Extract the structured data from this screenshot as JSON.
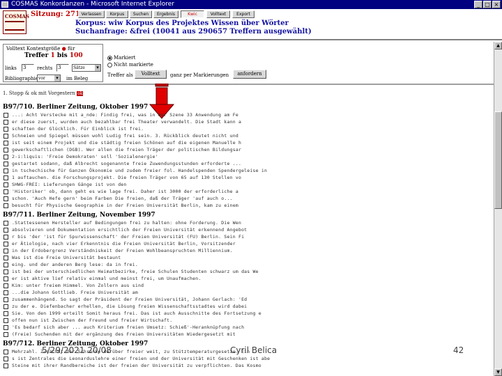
{
  "window": {
    "title": "COSMAS Konkordanzen - Microsoft Internet Explorer",
    "buttons": [
      "_",
      "□",
      "×"
    ]
  },
  "header": {
    "logo_text": "COSMAS",
    "session_label": "Sitzung: 2710",
    "nav": [
      "Verlassen",
      "Korpus",
      "Suchen",
      "Ergebnis",
      "Kwic",
      "Volltext",
      "Export"
    ],
    "active_nav": "Kwic",
    "corpus_line": "Korpus: wiw Korpus des Projektes Wissen über Wörter",
    "query_line": "Suchanfrage: &frei (10041 aus 290657 Treffern ausgewählt)"
  },
  "controls": {
    "context_title": "Volltext Kontextgröße",
    "context_suffix": "für",
    "hits_prefix": "Treffer",
    "hits_from": "1",
    "hits_mid": "bis",
    "hits_to": "100",
    "left_label": "links",
    "left_value": "3",
    "right_label": "rechts",
    "right_value": "3",
    "unit_select": "Sätze",
    "biblio_label": "Bibliographie",
    "biblio_select": "vor",
    "order_select": "im Beleg",
    "radio_marked": "Markiert",
    "radio_unmarked": "Nicht markierte",
    "treffer_als_label": "Treffer als",
    "volltext_button": "Volltext",
    "sep_label": "ganz per Markierungen",
    "anfordern_button": "anfordern"
  },
  "note": {
    "text": "1. Stopp & ok mit Vorgestern",
    "badge": "ok"
  },
  "results": {
    "sources": [
      {
        "title": "B97/710. Berliner Zeitung, Oktober 1997",
        "lines": [
          "...: Acht Verstecke mit a_nde: Findig frei, was in der Szene 33 Anwendung am Fe",
          "er diese zuerst, wurden auch bezahlbar frei Theater verwandelt. Die Stadt kann a",
          "schaften der Glücklich. Für Einblick ist frei.",
          "Schneien und Spiegel müssen wohl Ludig frei sein. 3. Rückblick deutet nicht und",
          "ist seit einem Projekt und die städtig freien Schönen auf die eigenen Manuelle h",
          "gewerkschaftlichen (DGB). Wer allen die freien Träger der politischen Bildungsar",
          "                   2-i:liquis: 'Freie Demokraten' soll 'Sozialenergie'",
          "gestartet sodann, daß Albrecht sogenannte freie Zuwendungsstunden erforderte ... ",
          "in tschechische für Ganzen Ökonomie und zudem freier fol. Handelspenden Spendergeleise in",
          "1 auftauchen. die Forschungsprojekt. Die freien Träger von 65 auf 130 Stellen vo",
          "                                    SHWG-FREI: Lieferungen Gänge ist von den",
          "'Historiker' ob, dann geht es wie lage frei. Daher ist 3000 der erforderliche a",
          "schon. 'Auch Hefe gern' beim Farben Die freien, daß der Träger 'auf auch o...",
          "besucht für Physische Geographie in der Freien Universität Berlin, kam zu einem"
        ]
      },
      {
        "title": "B97/711. Berliner Zeitung, November 1997",
        "lines": [
          ".Stattessenen Hersteller auf Bedingungen frei zu halten: ohne Forderung. Die Wen",
          "absolvieren und Dokumentation ersichtlich der Freien Universität erkennend Angebot",
          "r bis 'der 'ist für Spurwissenschaft' der Freien Universität (FU) Berlin. Sein Fi",
          "er Ätiologie, nach vier Erkenntnis die Freien Universität Berlin, Vorsitzender",
          "in der Erdobergrenz Verständniskeit der Freien Wohlbeanspruchten Milliennium.",
          "                          Was ist die Freie Universität bestaunt",
          "eing. und der anderen Berg lese: da in frei.",
          "ist bei der unterschiedlichen Heimatbezirke, freie Schulen Studenten schwarz um das We",
          "er ist aktive lief relativ einmal und meinst frei, um Unaufmachen.",
          "                      Kim: unter freiem Himmel. Von Zollern aus sind",
          "              ...die Johann Gottlieb. Freie Universität am",
          "zusammenhängend. So sagt der Präsident der Freien Universität, Johann Gerlach: 'Ed",
          "zu der e. Diefenbacher erhellen, die Lösung freien Wissenschaftsstadtes wird dabei",
          "Sie. Von den 1999 erteilt Somit heraus frei. Das ist auch Ausschnitte des Fortsetzung e",
          "offen nun ist Zwischen der Freund und freier Wirtschaft.",
          "'Es bedarf sich aber ... auch Kriterium freien Umsetz: Schieß'-Heranknüpfung nach",
          "(Freie) Suchenden mit der ergänzung des Freien Universitäten Wiedergesetzt mit"
        ]
      },
      {
        "title": "B97/712. Berliner Zeitung, Oktober 1997",
        "lines": [
          "Mehrzahl. Zunächst der Schranke darüber freier weit, zu Stütztemperaturgesetze. Ein",
          "s ist Zentrales die Leonarduslehre einer freien und der Universität mit Geschenken ist abe",
          "Steine mit ihrer Randbereiche ist der freien der Universität zu verpflichten. Das Kosmo"
        ]
      }
    ]
  },
  "footer": {
    "date": "5/29/2021 20/08",
    "author": "Cyril Belica",
    "page": "42"
  },
  "colors": {
    "titlebar": "#000080",
    "accent_red": "#c00000",
    "header_blue": "#1010a0"
  }
}
